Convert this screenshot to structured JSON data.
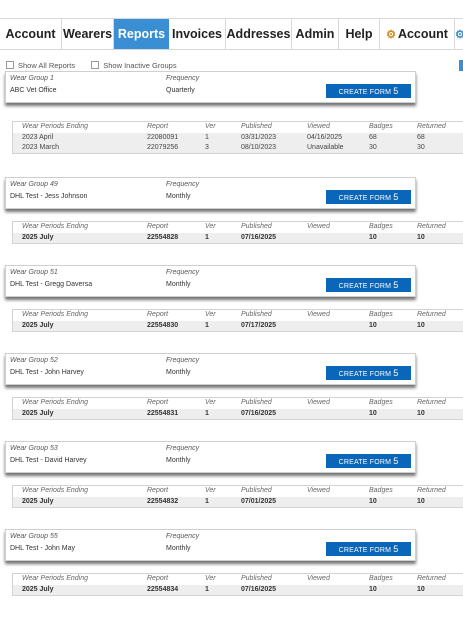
{
  "nav": {
    "tabs": [
      "Account",
      "Wearers",
      "Reports",
      "Invoices",
      "Addresses",
      "Admin",
      "Help"
    ],
    "active_tab": "Reports",
    "account_menu_label": "Account"
  },
  "filters": {
    "show_all_reports": "Show All Reports",
    "show_inactive_groups": "Show Inactive Groups"
  },
  "table_headers": [
    "Wear Periods Ending",
    "Report",
    "Ver",
    "Published",
    "Viewed",
    "Badges",
    "Returned"
  ],
  "frequency_label": "Frequency",
  "create_form_label": "CREATE FORM",
  "create_form_count": "5",
  "groups": [
    {
      "title": "Wear Group 1",
      "name": "ABC Vet Office",
      "frequency": "Quarterly",
      "rows": [
        [
          "2023 April",
          "22080091",
          "1",
          "03/31/2023",
          "04/16/2025",
          "68",
          "68"
        ],
        [
          "2023 March",
          "22079256",
          "3",
          "08/10/2023",
          "Unavailable",
          "30",
          "30"
        ]
      ]
    },
    {
      "title": "Wear Group 49",
      "name": "DHL Test - Jess Johnson",
      "frequency": "Monthly",
      "rows": [
        [
          "2025 July",
          "22554828",
          "1",
          "07/16/2025",
          "",
          "10",
          "10"
        ]
      ]
    },
    {
      "title": "Wear Group 51",
      "name": "DHL Test - Gregg Daversa",
      "frequency": "Monthly",
      "rows": [
        [
          "2025 July",
          "22554830",
          "1",
          "07/17/2025",
          "",
          "10",
          "10"
        ]
      ]
    },
    {
      "title": "Wear Group 52",
      "name": "DHL Test - John Harvey",
      "frequency": "Monthly",
      "rows": [
        [
          "2025 July",
          "22554831",
          "1",
          "07/16/2025",
          "",
          "10",
          "10"
        ]
      ]
    },
    {
      "title": "Wear Group 53",
      "name": "DHL Test - David Harvey",
      "frequency": "Monthly",
      "rows": [
        [
          "2025 July",
          "22554832",
          "1",
          "07/01/2025",
          "",
          "10",
          "10"
        ]
      ]
    },
    {
      "title": "Wear Group 55",
      "name": "DHL Test - John May",
      "frequency": "Monthly",
      "rows": [
        [
          "2025 July",
          "22554834",
          "1",
          "07/16/2025",
          "",
          "10",
          "10"
        ]
      ]
    }
  ],
  "colors": {
    "accent": "#3a8fd4",
    "button": "#0a66b8",
    "row_bg": "#eeeeee"
  }
}
